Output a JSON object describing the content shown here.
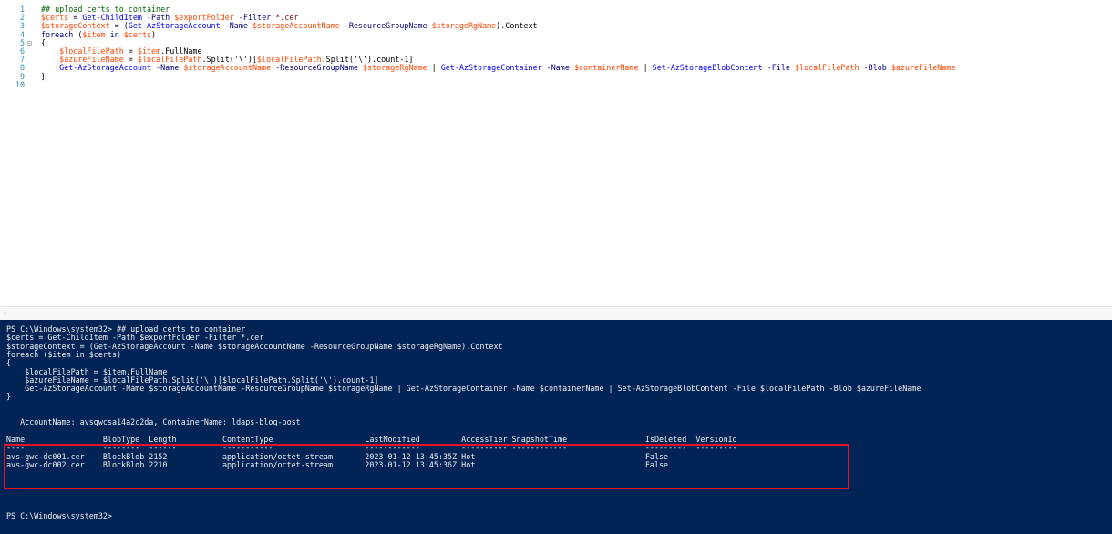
{
  "editor": {
    "lines": [
      {
        "n": "1",
        "fold": "",
        "segments": [
          {
            "t": "## upload certs to container",
            "c": "c-comment"
          }
        ]
      },
      {
        "n": "2",
        "fold": "",
        "segments": [
          {
            "t": "$certs",
            "c": "c-var"
          },
          {
            "t": " = ",
            "c": "c-plain"
          },
          {
            "t": "Get-ChildItem",
            "c": "c-cmd"
          },
          {
            "t": " -Path ",
            "c": "c-param"
          },
          {
            "t": "$exportFolder",
            "c": "c-var"
          },
          {
            "t": " -Filter ",
            "c": "c-param"
          },
          {
            "t": "*.cer",
            "c": "c-str"
          }
        ]
      },
      {
        "n": "3",
        "fold": "",
        "segments": [
          {
            "t": "$storageContext",
            "c": "c-var"
          },
          {
            "t": " = (",
            "c": "c-plain"
          },
          {
            "t": "Get-AzStorageAccount",
            "c": "c-cmd"
          },
          {
            "t": " -Name ",
            "c": "c-param"
          },
          {
            "t": "$storageAccountName",
            "c": "c-var"
          },
          {
            "t": " -ResourceGroupName ",
            "c": "c-param"
          },
          {
            "t": "$storageRgName",
            "c": "c-var"
          },
          {
            "t": ").Context",
            "c": "c-plain"
          }
        ]
      },
      {
        "n": "4",
        "fold": "",
        "segments": [
          {
            "t": "foreach",
            "c": "c-kw"
          },
          {
            "t": " (",
            "c": "c-plain"
          },
          {
            "t": "$item",
            "c": "c-var"
          },
          {
            "t": " in ",
            "c": "c-kw"
          },
          {
            "t": "$certs",
            "c": "c-var"
          },
          {
            "t": ")",
            "c": "c-plain"
          }
        ]
      },
      {
        "n": "5",
        "fold": "⊟",
        "segments": [
          {
            "t": "{",
            "c": "c-plain"
          }
        ]
      },
      {
        "n": "6",
        "fold": "",
        "segments": [
          {
            "t": "    ",
            "c": "c-plain"
          },
          {
            "t": "$localFilePath",
            "c": "c-var"
          },
          {
            "t": " = ",
            "c": "c-plain"
          },
          {
            "t": "$item",
            "c": "c-var"
          },
          {
            "t": ".FullName",
            "c": "c-plain"
          }
        ]
      },
      {
        "n": "7",
        "fold": "",
        "segments": [
          {
            "t": "    ",
            "c": "c-plain"
          },
          {
            "t": "$azureFileName",
            "c": "c-var"
          },
          {
            "t": " = ",
            "c": "c-plain"
          },
          {
            "t": "$localFilePath",
            "c": "c-var"
          },
          {
            "t": ".Split('\\')[",
            "c": "c-plain"
          },
          {
            "t": "$localFilePath",
            "c": "c-var"
          },
          {
            "t": ".Split('\\').count-1]",
            "c": "c-plain"
          }
        ]
      },
      {
        "n": "8",
        "fold": "",
        "segments": [
          {
            "t": "    ",
            "c": "c-plain"
          },
          {
            "t": "Get-AzStorageAccount",
            "c": "c-cmd"
          },
          {
            "t": " -Name ",
            "c": "c-param"
          },
          {
            "t": "$storageAccountName",
            "c": "c-var"
          },
          {
            "t": " -ResourceGroupName ",
            "c": "c-param"
          },
          {
            "t": "$storageRgName",
            "c": "c-var"
          },
          {
            "t": " | ",
            "c": "c-plain"
          },
          {
            "t": "Get-AzStorageContainer",
            "c": "c-cmd"
          },
          {
            "t": " -Name ",
            "c": "c-param"
          },
          {
            "t": "$containerName",
            "c": "c-var"
          },
          {
            "t": " | ",
            "c": "c-plain"
          },
          {
            "t": "Set-AzStorageBlobContent",
            "c": "c-cmd"
          },
          {
            "t": " -File ",
            "c": "c-param"
          },
          {
            "t": "$localFilePath",
            "c": "c-var"
          },
          {
            "t": " -Blob ",
            "c": "c-param"
          },
          {
            "t": "$azureFileName",
            "c": "c-var"
          }
        ]
      },
      {
        "n": "9",
        "fold": "",
        "segments": [
          {
            "t": "}",
            "c": "c-plain"
          }
        ]
      },
      {
        "n": "10",
        "fold": "",
        "segments": []
      }
    ]
  },
  "scrollbar": {
    "left_arrow": "‹"
  },
  "console": {
    "lines": [
      "PS C:\\Windows\\system32> ## upload certs to container",
      "$certs = Get-ChildItem -Path $exportFolder -Filter *.cer",
      "$storageContext = (Get-AzStorageAccount -Name $storageAccountName -ResourceGroupName $storageRgName).Context",
      "foreach ($item in $certs)",
      "{",
      "    $localFilePath = $item.FullName",
      "    $azureFileName = $localFilePath.Split('\\')[$localFilePath.Split('\\').count-1]",
      "    Get-AzStorageAccount -Name $storageAccountName -ResourceGroupName $storageRgName | Get-AzStorageContainer -Name $containerName | Set-AzStorageBlobContent -File $localFilePath -Blob $azureFileName",
      "}",
      "",
      "",
      "   AccountName: avsgwcsa14a2c2da, ContainerName: ldaps-blog-post",
      "",
      "Name                 BlobType  Length          ContentType                    LastModified         AccessTier SnapshotTime                 IsDeleted  VersionId",
      "----                 --------  ------          -----------                    ------------         ---------- ------------                 ---------  ---------",
      "avs-gwc-dc001.cer    BlockBlob 2152            application/octet-stream       2023-01-12 13:45:35Z Hot                                     False",
      "avs-gwc-dc002.cer    BlockBlob 2210            application/octet-stream       2023-01-12 13:45:36Z Hot                                     False",
      "",
      "",
      "",
      "",
      "",
      "PS C:\\Windows\\system32>"
    ]
  },
  "colors": {
    "console_bg": "#012456",
    "highlight_border": "#e81123"
  }
}
